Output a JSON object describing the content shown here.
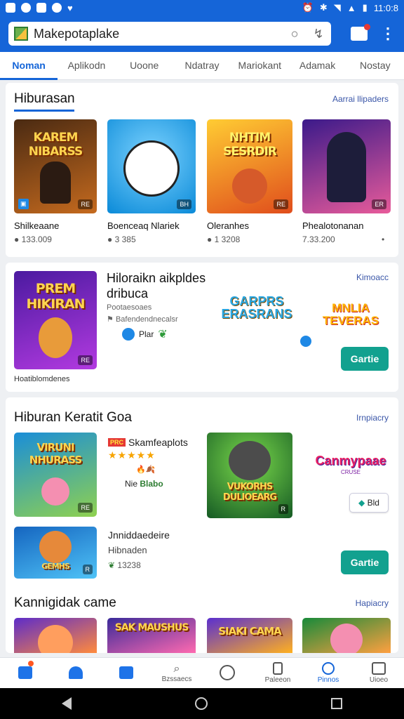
{
  "status": {
    "time": "11:0:8"
  },
  "search": {
    "text": "Makepotaplake"
  },
  "tabs": [
    "Noman",
    "Aplikodn",
    "Uoone",
    "Ndatray",
    "Mariokant",
    "Adamak",
    "Nostay"
  ],
  "section1": {
    "title": "Hiburasan",
    "link": "Aarrai llipaders",
    "apps": [
      {
        "name": "Shilkeaane",
        "meta": "133.009",
        "badge": "RE",
        "thumb_title": "KAREM NIBARSS",
        "colors": [
          "#4a2a12",
          "#c56a1e"
        ]
      },
      {
        "name": "Boenceaq Nlariek",
        "meta": "3 385",
        "badge": "BH",
        "thumb_title": "",
        "colors": [
          "#0a8ad8",
          "#7dd3ff"
        ]
      },
      {
        "name": "Oleranhes",
        "meta": "1 3208",
        "badge": "RE",
        "thumb_title": "NHTIM SESRDIR",
        "colors": [
          "#e04d1c",
          "#ffcc33"
        ]
      },
      {
        "name": "Phealotonanan",
        "meta": "7.33.200",
        "badge": "ER",
        "thumb_title": "",
        "colors": [
          "#3b1a8a",
          "#e85b9a"
        ]
      }
    ]
  },
  "section2": {
    "thumb_title": "PREM HIKIRAN",
    "thumb_caption": "Hoatiblomdenes",
    "title_line1": "Hiloraikn aikpldes",
    "title_line2": "dribuca",
    "sub": "Pootaesoaes",
    "sub2": "Bafendendnecalsr",
    "badge_label": "Plar",
    "link": "Kimoacc",
    "logo1": "GARPRS ERASRANS",
    "logo2": "MNLIA TEVERAS",
    "button": "Gartie"
  },
  "section3": {
    "title": "Hiburan Keratit Goa",
    "link": "Irnpiacry",
    "app1": {
      "thumb_title": "VIRUNI NHURASS",
      "name": "Skamfeaplots",
      "tag": "PRC",
      "stars": "★★★★★",
      "extra": "🔥🍂",
      "price_prefix": "Nie",
      "price": "Blabo"
    },
    "app2": {
      "thumb_title": "VUKORHS DULIOEARG"
    },
    "app3": {
      "logo": "Canmypaae",
      "logo_sub": "CRUSE",
      "chip": "Bld"
    },
    "app4": {
      "thumb_title": "GEMHS",
      "name": "Jnniddaedeire",
      "sub": "Hibnaden",
      "meta": "13238"
    },
    "button": "Gartie"
  },
  "section4": {
    "title": "Kannigidak came",
    "link": "Hapiacry",
    "thumbs": [
      {
        "title": "",
        "colors": [
          "#5d2cc9",
          "#ff8a3d"
        ]
      },
      {
        "title": "SAK MAUSHUS",
        "colors": [
          "#3a2a9a",
          "#ff6ab0"
        ]
      },
      {
        "title": "SIAKI CAMA",
        "colors": [
          "#5a2fd0",
          "#ffb020"
        ]
      },
      {
        "title": "",
        "colors": [
          "#188a3a",
          "#ffa040"
        ]
      }
    ]
  },
  "bottomnav": [
    {
      "label": "",
      "icon": "feed-icon"
    },
    {
      "label": "",
      "icon": "home-icon"
    },
    {
      "label": "",
      "icon": "list-icon"
    },
    {
      "label": "Bzssaecs",
      "icon": "search-icon"
    },
    {
      "label": "",
      "icon": "circle-icon"
    },
    {
      "label": "Paleeon",
      "icon": "bag-icon"
    },
    {
      "label": "Pinnos",
      "icon": "info-icon"
    },
    {
      "label": "Uioeo",
      "icon": "window-icon"
    }
  ]
}
